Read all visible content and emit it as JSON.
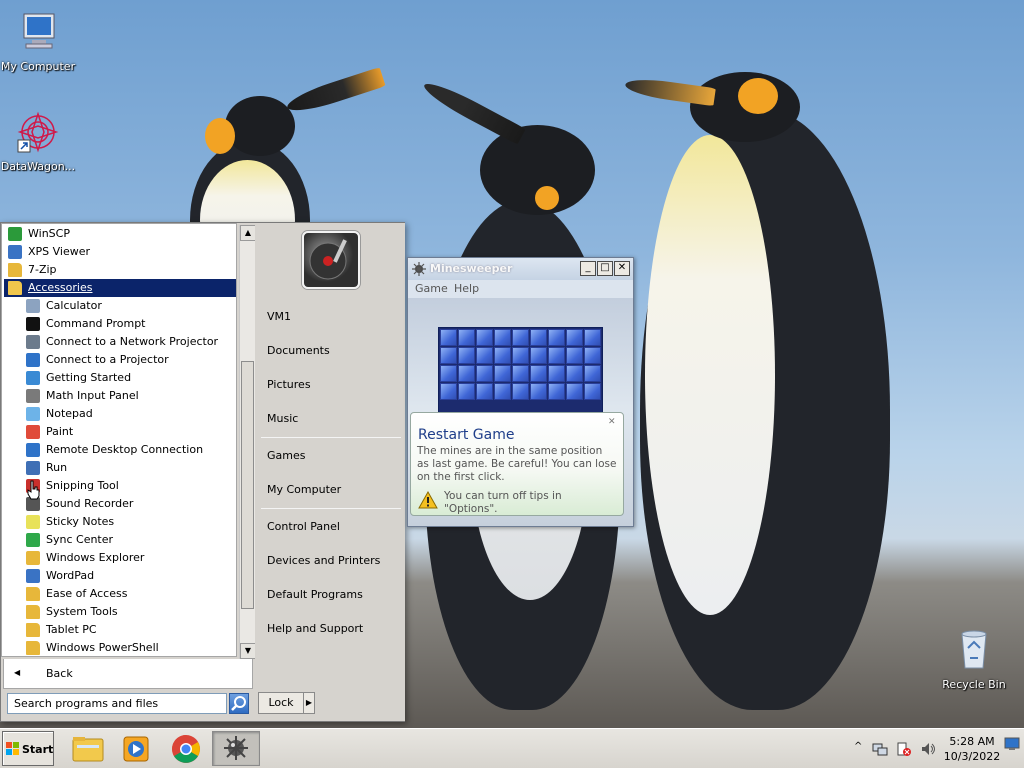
{
  "desktop": {
    "icons": [
      {
        "label": "My Computer"
      },
      {
        "label": "DataWagon..."
      },
      {
        "label": "Recycle Bin"
      }
    ]
  },
  "start_menu": {
    "programs": [
      {
        "label": "WinSCP",
        "icon": "winscp-icon"
      },
      {
        "label": "XPS Viewer",
        "icon": "xps-viewer-icon"
      },
      {
        "label": "7-Zip",
        "icon": "folder-icon"
      },
      {
        "label": "Accessories",
        "icon": "folder-open-icon",
        "selected": true
      },
      {
        "label": "Calculator",
        "icon": "calculator-icon"
      },
      {
        "label": "Command Prompt",
        "icon": "command-prompt-icon"
      },
      {
        "label": "Connect to a Network Projector",
        "icon": "network-projector-icon"
      },
      {
        "label": "Connect to a Projector",
        "icon": "projector-icon"
      },
      {
        "label": "Getting Started",
        "icon": "getting-started-icon"
      },
      {
        "label": "Math Input Panel",
        "icon": "math-input-icon"
      },
      {
        "label": "Notepad",
        "icon": "notepad-icon"
      },
      {
        "label": "Paint",
        "icon": "paint-icon"
      },
      {
        "label": "Remote Desktop Connection",
        "icon": "remote-desktop-icon"
      },
      {
        "label": "Run",
        "icon": "run-icon"
      },
      {
        "label": "Snipping Tool",
        "icon": "snipping-tool-icon"
      },
      {
        "label": "Sound Recorder",
        "icon": "sound-recorder-icon"
      },
      {
        "label": "Sticky Notes",
        "icon": "sticky-notes-icon"
      },
      {
        "label": "Sync Center",
        "icon": "sync-center-icon"
      },
      {
        "label": "Windows Explorer",
        "icon": "windows-explorer-icon"
      },
      {
        "label": "WordPad",
        "icon": "wordpad-icon"
      },
      {
        "label": "Ease of Access",
        "icon": "folder-icon"
      },
      {
        "label": "System Tools",
        "icon": "folder-icon"
      },
      {
        "label": "Tablet PC",
        "icon": "folder-icon"
      },
      {
        "label": "Windows PowerShell",
        "icon": "folder-icon"
      }
    ],
    "back_label": "Back",
    "search_placeholder": "Search programs and files",
    "right_items": {
      "vm1": "VM1",
      "documents": "Documents",
      "pictures": "Pictures",
      "music": "Music",
      "games": "Games",
      "my_computer": "My Computer",
      "control_panel": "Control Panel",
      "devices_printers": "Devices and Printers",
      "default_programs": "Default Programs",
      "help_support": "Help and Support"
    },
    "lock_label": "Lock"
  },
  "minesweeper": {
    "title": "Minesweeper",
    "menu": {
      "game": "Game",
      "help": "Help"
    },
    "grid": {
      "cols": 9,
      "rows": 4
    },
    "tip": {
      "title": "Restart Game",
      "body": "The mines are in the same position as last game. Be careful! You can lose on the first click.",
      "footer": "You can turn off tips in \"Options\"."
    }
  },
  "taskbar": {
    "start_label": "Start",
    "apps": [
      "windows-explorer-icon",
      "media-player-icon",
      "chrome-icon",
      "minesweeper-icon"
    ],
    "clock_time": "5:28 AM",
    "clock_date": "10/3/2022"
  },
  "colors": {
    "selection": "#0b246a",
    "menu_bg": "#d6d3ce",
    "mine_cell": "#3f66d6"
  }
}
